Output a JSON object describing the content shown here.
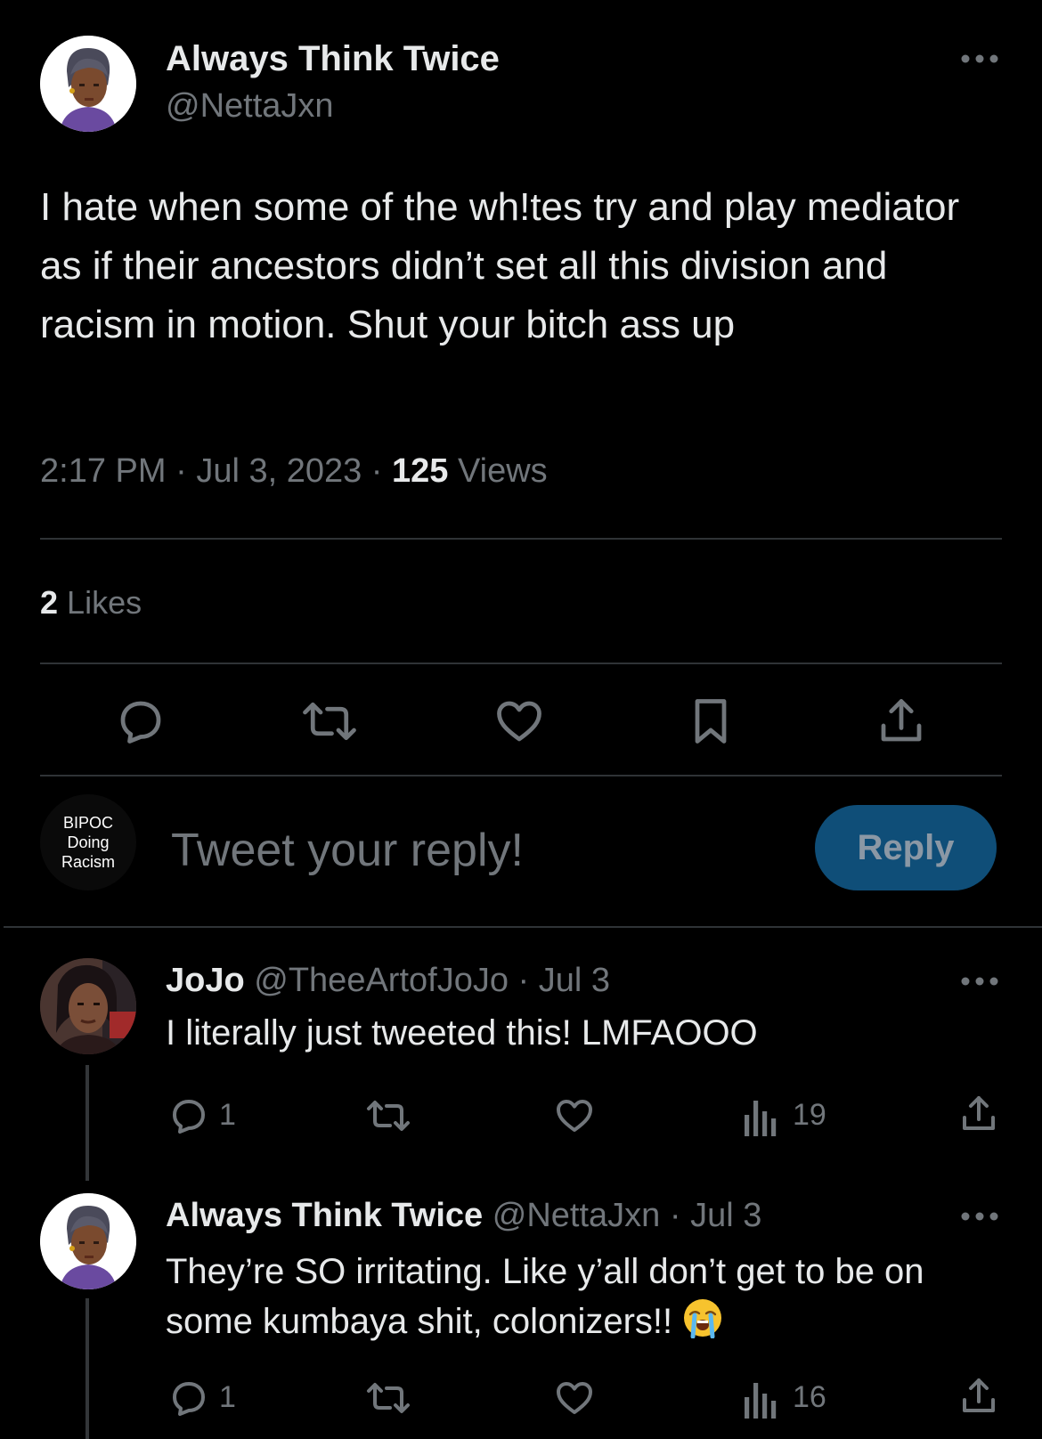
{
  "main_tweet": {
    "display_name": "Always Think Twice",
    "handle": "@NettaJxn",
    "text": "I hate when some of the wh!tes try and play mediator as if their ancestors didn’t set all this division and racism in motion. Shut your bitch ass up",
    "time": "2:17 PM",
    "date": "Jul 3, 2023",
    "sep": "·",
    "views_count": "125",
    "views_label": "Views",
    "likes_count": "2",
    "likes_label": "Likes"
  },
  "composer": {
    "avatar_lines": [
      "BIPOC",
      "Doing",
      "Racism"
    ],
    "placeholder": "Tweet your reply!",
    "reply_button": "Reply"
  },
  "replies": [
    {
      "display_name": "JoJo",
      "handle": "@TheeArtofJoJo",
      "sep": "·",
      "date": "Jul 3",
      "text": "I literally just tweeted this! LMFAOOO",
      "reply_count": "1",
      "views_count": "19"
    },
    {
      "display_name": "Always Think Twice",
      "handle": "@NettaJxn",
      "sep": "·",
      "date": "Jul 3",
      "text_line1": "They’re SO irritating. Like y’all don’t get to be on",
      "text_line2": "some kumbaya shit, colonizers!!",
      "emoji": "😭",
      "reply_count": "1",
      "views_count": "16"
    }
  ],
  "icons": {
    "more": "more-horizontal-icon",
    "reply": "reply-icon",
    "retweet": "retweet-icon",
    "like": "like-icon",
    "bookmark": "bookmark-icon",
    "share": "share-icon",
    "views": "views-icon"
  },
  "colors": {
    "background": "#000000",
    "text": "#e7e9ea",
    "muted": "#71767b",
    "divider": "#2f3336",
    "reply_button_bg": "#0f4e78",
    "reply_button_text": "#8b98a5"
  }
}
